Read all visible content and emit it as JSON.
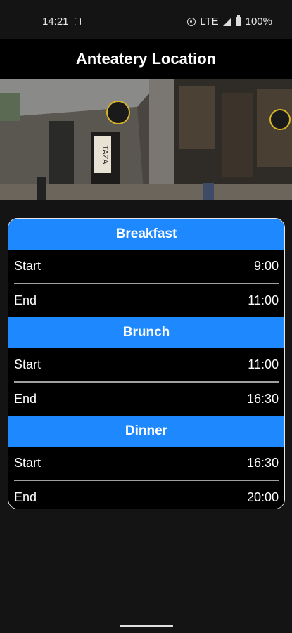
{
  "status_bar": {
    "time": "14:21",
    "network": "LTE",
    "battery": "100%"
  },
  "app_bar": {
    "title": "Anteatery Location"
  },
  "hero": {
    "storefront_sign": "TAZA"
  },
  "meals": [
    {
      "name": "Breakfast",
      "rows": [
        {
          "label": "Start",
          "time": "9:00"
        },
        {
          "label": "End",
          "time": "11:00"
        }
      ]
    },
    {
      "name": "Brunch",
      "rows": [
        {
          "label": "Start",
          "time": "11:00"
        },
        {
          "label": "End",
          "time": "16:30"
        }
      ]
    },
    {
      "name": "Dinner",
      "rows": [
        {
          "label": "Start",
          "time": "16:30"
        },
        {
          "label": "End",
          "time": "20:00"
        }
      ]
    }
  ],
  "colors": {
    "accent": "#1e88ff",
    "background": "#141414",
    "card": "#000000",
    "divider": "#a0a0a0"
  }
}
